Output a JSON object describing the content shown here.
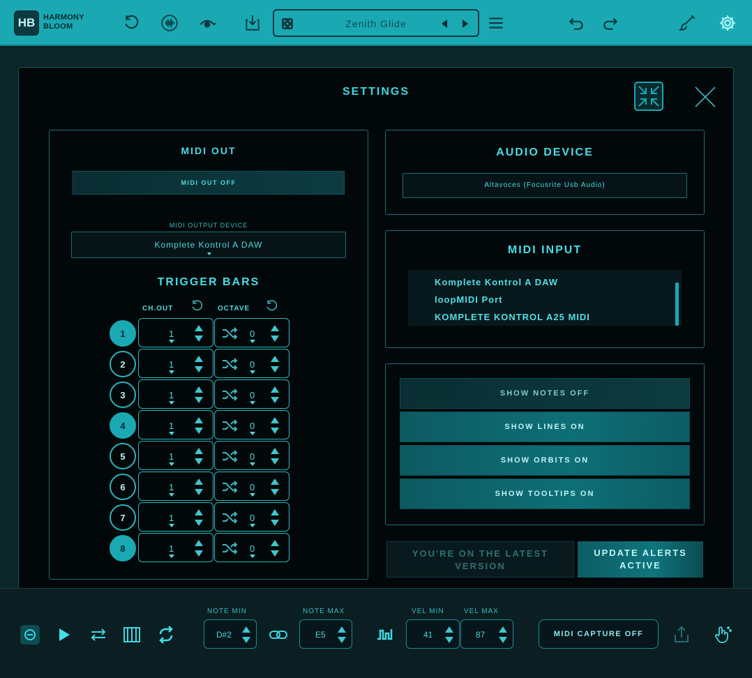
{
  "app": {
    "logo_initials": "HB",
    "logo_line1": "HARMONY",
    "logo_line2": "BLOOM",
    "preset_name": "Zenith Glide"
  },
  "settings": {
    "title": "SETTINGS",
    "midi_out": {
      "title": "MIDI OUT",
      "toggle_label": "MIDI OUT OFF",
      "device_label": "MIDI OUTPUT DEVICE",
      "device_value": "Komplete Kontrol A DAW"
    },
    "trigger_bars": {
      "title": "TRIGGER BARS",
      "ch_out_label": "CH.OUT",
      "octave_label": "OCTAVE",
      "rows": [
        {
          "num": "1",
          "ch": "1",
          "oct": "0",
          "active": true
        },
        {
          "num": "2",
          "ch": "1",
          "oct": "0",
          "active": false
        },
        {
          "num": "3",
          "ch": "1",
          "oct": "0",
          "active": false
        },
        {
          "num": "4",
          "ch": "1",
          "oct": "0",
          "active": true
        },
        {
          "num": "5",
          "ch": "1",
          "oct": "0",
          "active": false
        },
        {
          "num": "6",
          "ch": "1",
          "oct": "0",
          "active": false
        },
        {
          "num": "7",
          "ch": "1",
          "oct": "0",
          "active": false
        },
        {
          "num": "8",
          "ch": "1",
          "oct": "0",
          "active": true
        }
      ]
    },
    "audio_device": {
      "title": "AUDIO DEVICE",
      "value": "Altavoces (Focusrite Usb Audio)"
    },
    "midi_input": {
      "title": "MIDI INPUT",
      "items": [
        "Komplete Kontrol A DAW",
        "loopMIDI Port",
        "KOMPLETE KONTROL A25 MIDI"
      ]
    },
    "display_toggles": [
      {
        "label": "SHOW NOTES OFF",
        "state": "off"
      },
      {
        "label": "SHOW LINES ON",
        "state": "on"
      },
      {
        "label": "SHOW ORBITS ON",
        "state": "on"
      },
      {
        "label": "SHOW TOOLTIPS ON",
        "state": "on"
      }
    ],
    "version_status": {
      "line1": "YOU'RE ON THE LATEST",
      "line2": "VERSION"
    },
    "update_alerts": {
      "line1": "UPDATE ALERTS",
      "line2": "ACTIVE"
    }
  },
  "bottom": {
    "note_min_label": "NOTE MIN",
    "note_min_value": "D#2",
    "note_max_label": "NOTE MAX",
    "note_max_value": "E5",
    "vel_min_label": "VEL MIN",
    "vel_min_value": "41",
    "vel_max_label": "VEL MAX",
    "vel_max_value": "87",
    "midi_capture_label": "MIDI CAPTURE OFF"
  },
  "colors": {
    "accent": "#1aa9b3",
    "text": "#3fd6e0",
    "background": "#020809"
  }
}
